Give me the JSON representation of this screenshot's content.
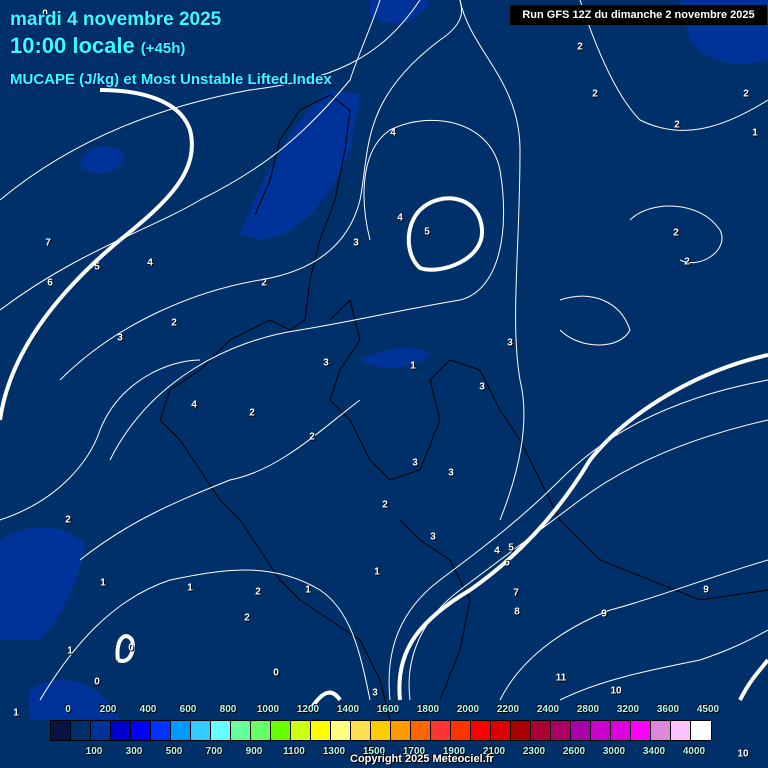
{
  "header": {
    "date": "mardi 4 novembre 2025",
    "time": "10:00 locale",
    "offset": "(+45h)",
    "parameter": "MUCAPE (J/kg) et Most Unstable Lifted Index"
  },
  "run_label": "Run GFS 12Z du dimanche 2 novembre 2025",
  "copyright": "Copyright 2025 Meteociel.fr",
  "legend": {
    "top_labels": [
      "0",
      "200",
      "400",
      "600",
      "800",
      "1000",
      "1200",
      "1400",
      "1600",
      "1800",
      "2000",
      "2200",
      "2400",
      "2800",
      "3200",
      "3600",
      "4500"
    ],
    "bottom_labels": [
      "100",
      "300",
      "500",
      "700",
      "900",
      "1100",
      "1300",
      "1500",
      "1700",
      "1900",
      "2100",
      "2300",
      "2600",
      "3000",
      "3400",
      "4000"
    ],
    "colors": [
      "#0a1444",
      "#00306a",
      "#00339a",
      "#0000cc",
      "#0000ff",
      "#0033ff",
      "#0099ff",
      "#33ccff",
      "#66ffff",
      "#66ff99",
      "#66ff66",
      "#66ff00",
      "#ccff11",
      "#ffff00",
      "#ffff80",
      "#ffe050",
      "#ffcc00",
      "#ff9900",
      "#ff6600",
      "#ff3333",
      "#ff3300",
      "#ff0000",
      "#dd0000",
      "#aa0000",
      "#aa0033",
      "#aa0066",
      "#aa00aa",
      "#cc00cc",
      "#dd00dd",
      "#ff00ff",
      "#dd88dd",
      "#ffc0ff",
      "#ffffff"
    ]
  },
  "contour_labels": [
    "0",
    "2",
    "2",
    "1",
    "7",
    "5",
    "4",
    "6",
    "3",
    "2",
    "2",
    "4",
    "4",
    "3",
    "5",
    "2",
    "2",
    "3",
    "1",
    "3",
    "4",
    "2",
    "2",
    "3",
    "3",
    "3",
    "2",
    "3",
    "1",
    "2",
    "2",
    "1",
    "1",
    "2",
    "1",
    "0",
    "0",
    "1",
    "0",
    "3",
    "4",
    "5",
    "6",
    "7",
    "8",
    "9",
    "9",
    "11",
    "10",
    "10",
    "2",
    "2",
    "1"
  ],
  "colors": {
    "background": "#00306a",
    "patch": "#00339a",
    "contour": "#ffffff",
    "title": "#33ffff"
  }
}
